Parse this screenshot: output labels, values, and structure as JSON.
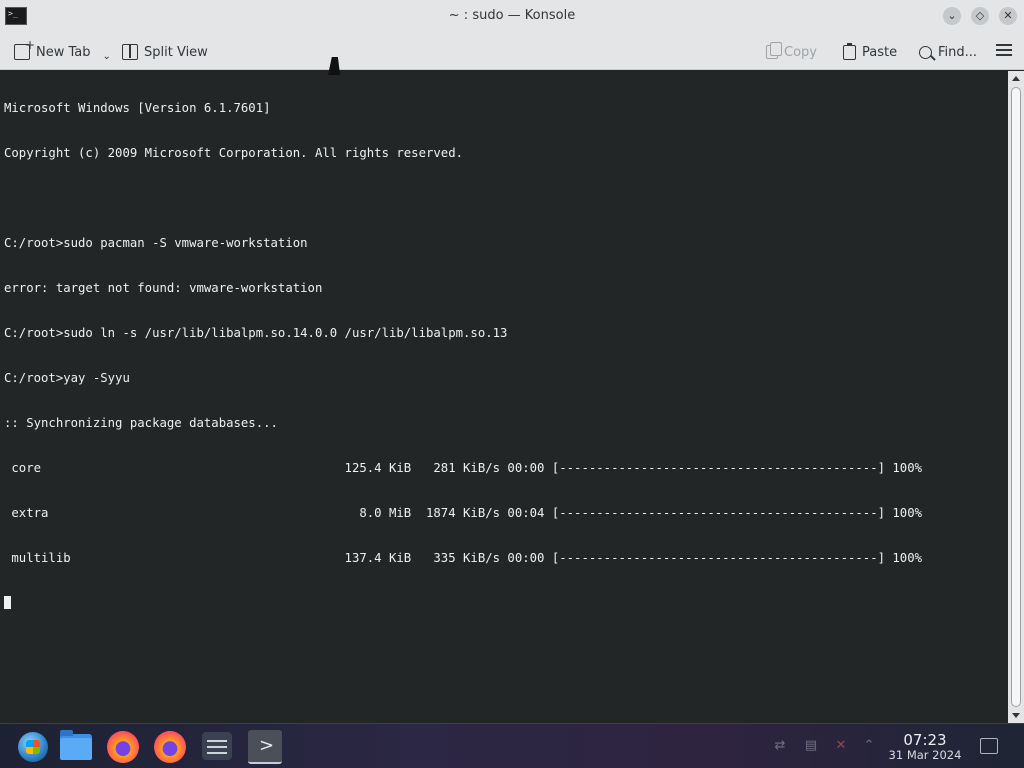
{
  "window": {
    "title": "~ : sudo — Konsole",
    "buttons": [
      "minimize",
      "maximize",
      "close"
    ]
  },
  "toolbar": {
    "new_tab": "New Tab",
    "split_view": "Split View",
    "copy": "Copy",
    "paste": "Paste",
    "find": "Find..."
  },
  "terminal": {
    "lines": [
      "Microsoft Windows [Version 6.1.7601]",
      "Copyright (c) 2009 Microsoft Corporation. All rights reserved.",
      "",
      "C:/root>sudo pacman -S vmware-workstation",
      "error: target not found: vmware-workstation",
      "C:/root>sudo ln -s /usr/lib/libalpm.so.14.0.0 /usr/lib/libalpm.so.13",
      "C:/root>yay -Syyu",
      ":: Synchronizing package databases...",
      " core                                         125.4 KiB   281 KiB/s 00:00 [-------------------------------------------] 100%",
      " extra                                          8.0 MiB  1874 KiB/s 00:04 [-------------------------------------------] 100%",
      " multilib                                     137.4 KiB   335 KiB/s 00:00 [-------------------------------------------] 100%"
    ]
  },
  "taskbar": {
    "apps": [
      "start-menu",
      "file-manager",
      "firefox",
      "firefox",
      "system-settings",
      "konsole"
    ],
    "clock_time": "07:23",
    "clock_date": "31 Mar 2024"
  },
  "colors": {
    "terminal_bg": "#232627",
    "terminal_fg": "#eff0f1",
    "chrome_bg": "#e3e5e7"
  }
}
